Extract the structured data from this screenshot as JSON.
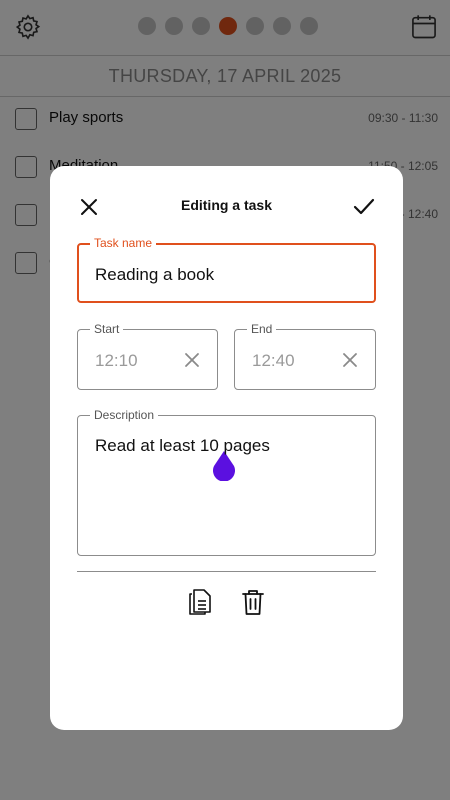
{
  "header": {
    "settings_icon": "gear-icon",
    "calendar_icon": "calendar-icon",
    "day_dots_count": 7,
    "active_day_index": 3,
    "accent_color": "#e0501d"
  },
  "date_label": "THURSDAY, 17 APRIL 2025",
  "tasks": [
    {
      "name": "Play sports",
      "time": "09:30 - 11:30"
    },
    {
      "name": "Meditation",
      "time": "11:50 - 12:05"
    },
    {
      "name": "",
      "time": "- 12:40"
    },
    {
      "name": "C",
      "time": ""
    }
  ],
  "dialog": {
    "title": "Editing a task",
    "close_icon": "close-icon",
    "confirm_icon": "check-icon",
    "task_name": {
      "label": "Task name",
      "value": "Reading a book"
    },
    "start": {
      "label": "Start",
      "value": "12:10"
    },
    "end": {
      "label": "End",
      "value": "12:40"
    },
    "description": {
      "label": "Description",
      "value": "Read at least 10 pages"
    },
    "actions": {
      "copy_icon": "copy-icon",
      "delete_icon": "trash-icon"
    },
    "handle_color": "#5b10e0"
  }
}
